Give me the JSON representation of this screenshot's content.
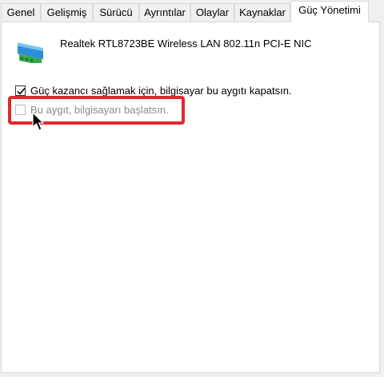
{
  "tabs": [
    {
      "label": "Genel",
      "active": false
    },
    {
      "label": "Gelişmiş",
      "active": false
    },
    {
      "label": "Sürücü",
      "active": false
    },
    {
      "label": "Ayrıntılar",
      "active": false
    },
    {
      "label": "Olaylar",
      "active": false
    },
    {
      "label": "Kaynaklar",
      "active": false
    },
    {
      "label": "Güç Yönetimi",
      "active": true
    }
  ],
  "device": {
    "name": "Realtek RTL8723BE Wireless LAN 802.11n PCI-E NIC",
    "icon": "network-adapter-icon"
  },
  "options": {
    "allow_turn_off": {
      "label": "Güç kazancı sağlamak için, bilgisayar bu aygıtı kapatsın.",
      "checked": true,
      "enabled": true
    },
    "allow_wake": {
      "label": "Bu aygıt, bilgisayarı başlatsın.",
      "checked": false,
      "enabled": false
    }
  },
  "colors": {
    "highlight": "#e0282d",
    "disabled_text": "#8a8a8a"
  }
}
